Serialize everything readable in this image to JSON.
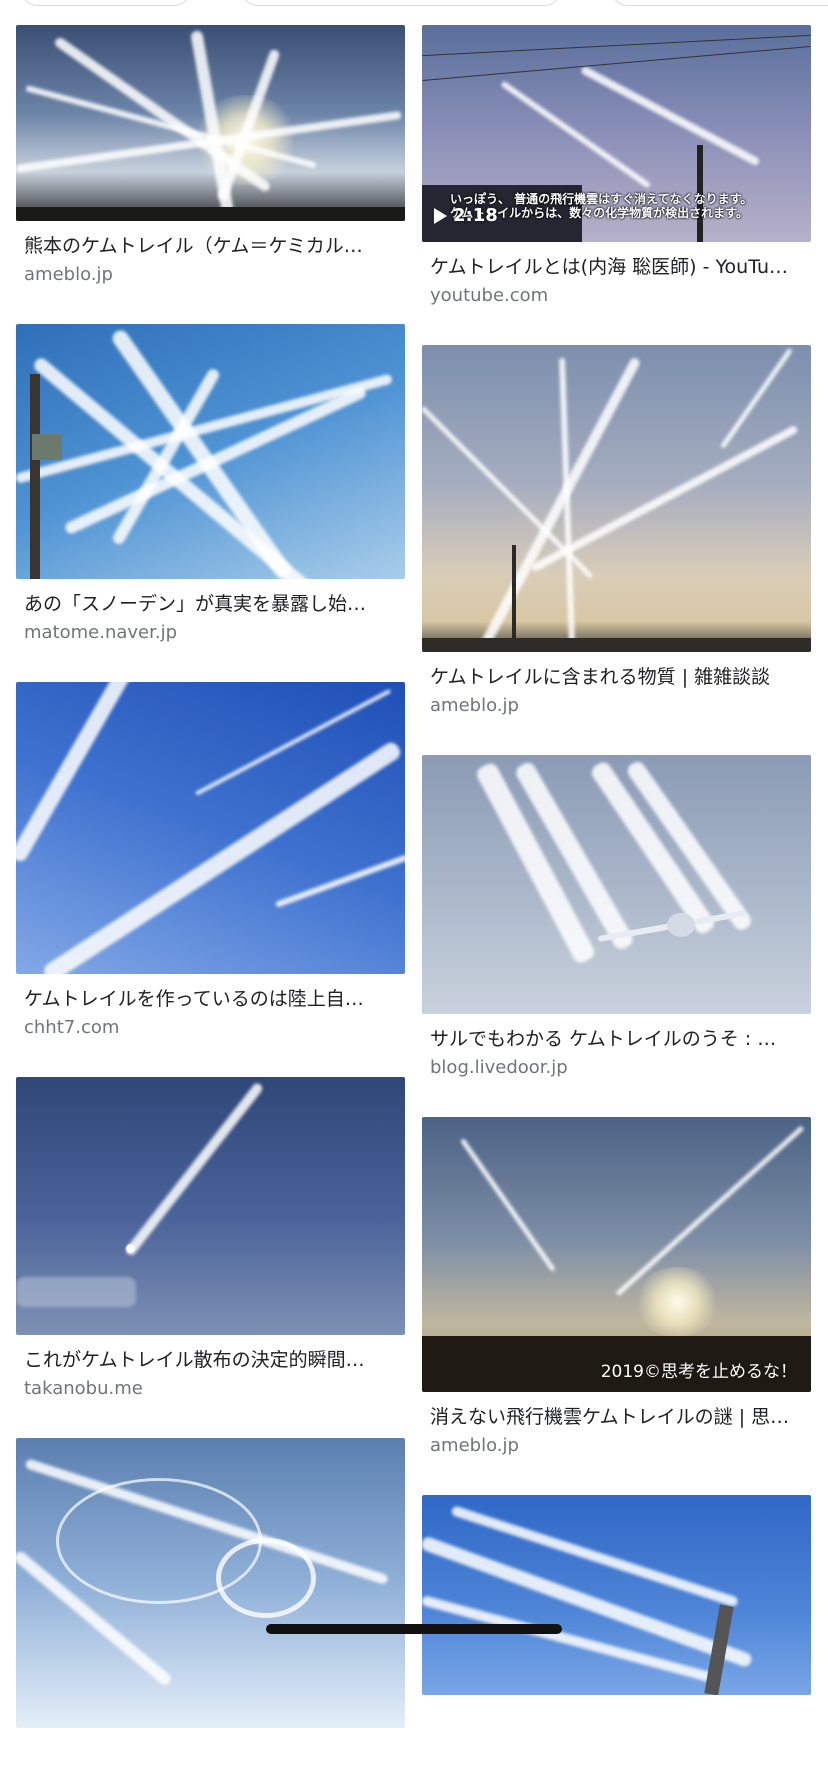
{
  "results": {
    "left": [
      {
        "title": "熊本のケムトレイル（ケム＝ケミカル…",
        "domain": "ameblo.jp"
      },
      {
        "title": "あの「スノーデン」が真実を暴露し始…",
        "domain": "matome.naver.jp"
      },
      {
        "title": "ケムトレイルを作っているのは陸上自…",
        "domain": "chht7.com"
      },
      {
        "title": "これがケムトレイル散布の決定的瞬間…",
        "domain": "takanobu.me"
      }
    ],
    "right": [
      {
        "title": "ケムトレイルとは(内海 聡医師) - YouTu…",
        "domain": "youtube.com",
        "duration": "2:18",
        "subtitle_line1": "いっぽう、 普通の飛行機雲はすぐ消えてなくなります。",
        "subtitle_line2": "ケムトレイルからは、数々の化学物質が検出されます。"
      },
      {
        "title": "ケムトレイルに含まれる物質 | 雑雑談談",
        "domain": "ameblo.jp"
      },
      {
        "title": "サルでもわかる ケムトレイルのうそ : …",
        "domain": "blog.livedoor.jp"
      },
      {
        "title": "消えない飛行機雲ケムトレイルの謎 | 思…",
        "domain": "ameblo.jp",
        "watermark": "2019©思考を止めるな！"
      }
    ]
  },
  "icons": {
    "play": "play-icon"
  }
}
